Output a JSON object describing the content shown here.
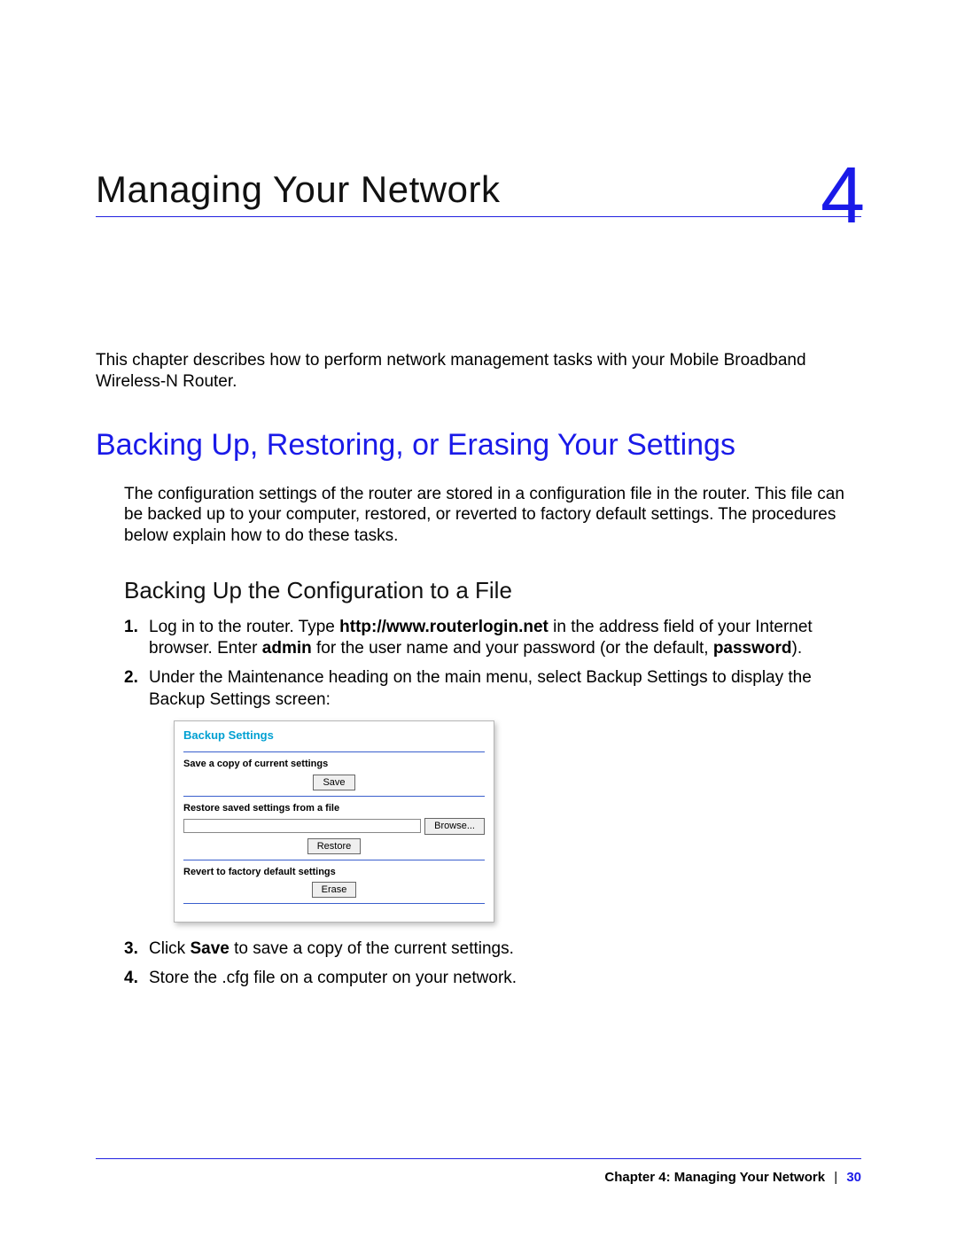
{
  "chapter": {
    "number": "4",
    "title": "Managing Your Network"
  },
  "intro": "This chapter describes how to perform network management tasks with your Mobile Broadband Wireless-N Router.",
  "section": {
    "title": "Backing Up, Restoring, or Erasing Your Settings",
    "intro": "The configuration settings of the router are stored in a configuration file in the router. This file can be backed up to your computer, restored, or reverted to factory default settings. The procedures below explain how to do these tasks.",
    "subsection_title": "Backing Up the Configuration to a File",
    "steps": {
      "s1_a": "Log in to the router. Type ",
      "s1_b_bold": "http://www.routerlogin.net",
      "s1_c": " in the address field of your Internet browser. Enter ",
      "s1_d_bold": "admin",
      "s1_e": " for the user name and your password (or the default, ",
      "s1_f_bold": "password",
      "s1_g": ").",
      "s2": "Under the Maintenance heading on the main menu, select Backup Settings to display the Backup Settings screen:",
      "s3_a": "Click ",
      "s3_b_bold": "Save",
      "s3_c": " to save a copy of the current settings.",
      "s4": "Store the .cfg file on a computer on your network."
    }
  },
  "screenshot": {
    "title": "Backup Settings",
    "save_copy_label": "Save a copy of current settings",
    "save_btn": "Save",
    "restore_label": "Restore saved settings from a file",
    "browse_btn": "Browse...",
    "restore_btn": "Restore",
    "revert_label": "Revert to factory default settings",
    "erase_btn": "Erase"
  },
  "footer": {
    "chapter_label": "Chapter 4:  Managing Your Network",
    "separator": "|",
    "page_number": "30"
  }
}
